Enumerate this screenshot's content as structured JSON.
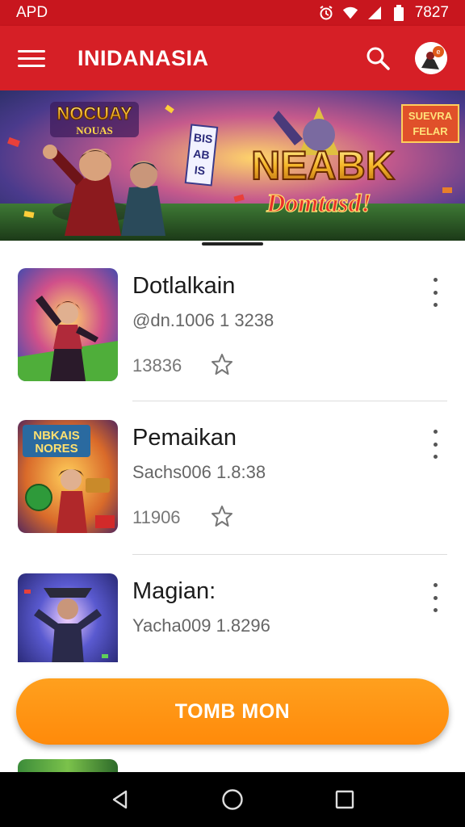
{
  "status_bar": {
    "left_text": "APD",
    "time": "7827"
  },
  "app_bar": {
    "title": "INIDANASIA"
  },
  "banner": {
    "badge_left_line1": "NOCUAY",
    "badge_left_line2": "NOUAS",
    "side_text": [
      "BIS",
      "AB",
      "IS"
    ],
    "headline": "NEABK",
    "subheadline": "Domtasd!",
    "tag_line1": "SUEVRA",
    "tag_line2": "FELAR"
  },
  "items": [
    {
      "title": "Dotlalkain",
      "subtitle": "@dn.1006 1 3238",
      "count": "13836"
    },
    {
      "title": "Pemaikan",
      "subtitle": "Sachs006 1.8:38",
      "count": "11906"
    },
    {
      "title": "Magian:",
      "subtitle": "Yacha009 1.8296",
      "count": ""
    }
  ],
  "cta": {
    "label": "TOMB MON"
  },
  "colors": {
    "primary": "#d61f26",
    "accent": "#ff8c0c"
  }
}
